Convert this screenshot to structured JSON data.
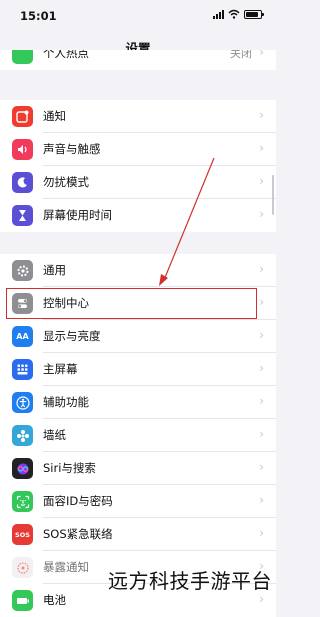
{
  "status_bar": {
    "time": "15:01"
  },
  "page": {
    "title": "设置"
  },
  "top_partial_row": {
    "label": "个人热点",
    "value": "关闭"
  },
  "group1": [
    {
      "label": "通知",
      "icon": "notifications-icon",
      "color": "#f23b2f"
    },
    {
      "label": "声音与触感",
      "icon": "sound-icon",
      "color": "#f23b5a"
    },
    {
      "label": "勿扰模式",
      "icon": "moon-icon",
      "color": "#5b4fd6"
    },
    {
      "label": "屏幕使用时间",
      "icon": "hourglass-icon",
      "color": "#5b4fd6"
    }
  ],
  "group2": [
    {
      "label": "通用",
      "icon": "gear-icon",
      "color": "#8e8e93"
    },
    {
      "label": "控制中心",
      "icon": "switches-icon",
      "color": "#8e8e93"
    },
    {
      "label": "显示与亮度",
      "icon": "display-icon",
      "color": "#1f7ef0",
      "glyph": "AA"
    },
    {
      "label": "主屏幕",
      "icon": "home-screen-icon",
      "color": "#2a6cf0"
    },
    {
      "label": "辅助功能",
      "icon": "accessibility-icon",
      "color": "#1f7ef0"
    },
    {
      "label": "墙纸",
      "icon": "wallpaper-icon",
      "color": "#34a7d8"
    },
    {
      "label": "Siri与搜索",
      "icon": "siri-icon",
      "color": "#222222"
    },
    {
      "label": "面容ID与密码",
      "icon": "face-id-icon",
      "color": "#34c759"
    },
    {
      "label": "SOS紧急联络",
      "icon": "sos-icon",
      "color": "#e53a35",
      "glyph": "SOS"
    },
    {
      "label": "暴露通知",
      "icon": "exposure-icon",
      "color": "#f4f0f0"
    },
    {
      "label": "电池",
      "icon": "battery-icon",
      "color": "#34c759"
    }
  ],
  "watermark": "远方科技手游平台",
  "accent": {
    "highlight": "#d0312d"
  }
}
